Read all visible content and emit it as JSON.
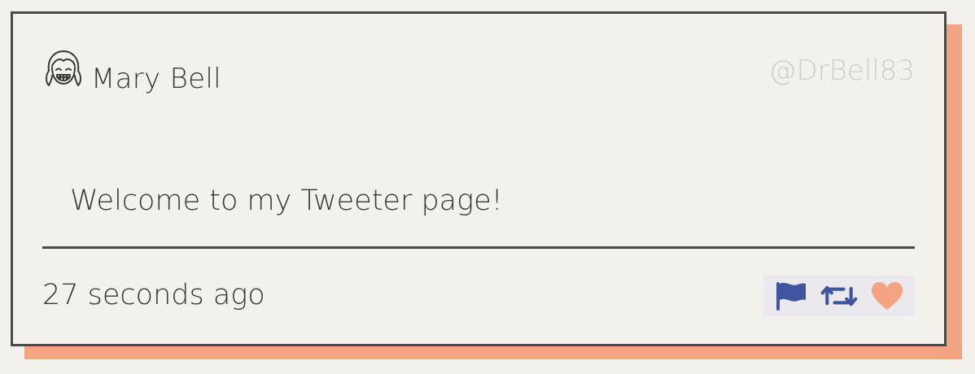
{
  "tweet": {
    "author_name": "Mary Bell",
    "handle": "@DrBell83",
    "content": "Welcome to my Tweeter page!",
    "timestamp": "27 seconds ago"
  },
  "icons": {
    "avatar": "girl-avatar-icon",
    "flag": "flag-icon",
    "retweet": "retweet-icon",
    "like": "heart-icon"
  },
  "colors": {
    "background": "#f3f1ec",
    "border": "#4b4a45",
    "shadow": "#f4a482",
    "text": "#3a3935",
    "handle": "#d0cec8",
    "action_blue": "#3f55a0",
    "heart": "#f4a482"
  }
}
